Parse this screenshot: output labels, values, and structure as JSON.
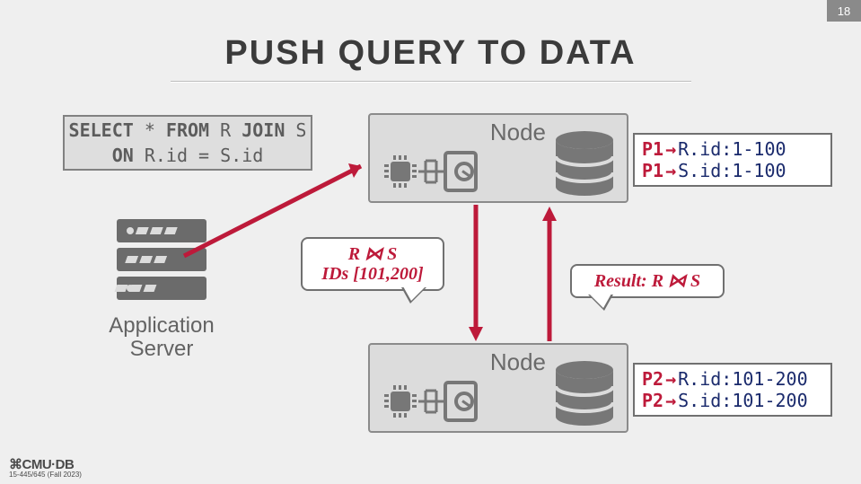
{
  "page_number": "18",
  "title": "PUSH QUERY TO DATA",
  "footer": {
    "logo": "⌘CMU·DB",
    "course": "15-445/645 (Fall 2023)"
  },
  "sql": {
    "line1_kw1": "SELECT",
    "line1_mid": " * ",
    "line1_kw2": "FROM",
    "line1_r": " R ",
    "line1_kw3": "JOIN",
    "line1_s": " S",
    "line2_kw": "ON",
    "line2_cond": " R.id = S.id"
  },
  "appserver_label_l1": "Application",
  "appserver_label_l2": "Server",
  "node_label": "Node",
  "partitions": {
    "p1": [
      {
        "p": "P1",
        "range": "R.id:1-100"
      },
      {
        "p": "P1",
        "range": "S.id:1-100"
      }
    ],
    "p2": [
      {
        "p": "P2",
        "range": "R.id:101-200"
      },
      {
        "p": "P2",
        "range": "S.id:101-200"
      }
    ]
  },
  "bubble1_l1": "R ⋈ S",
  "bubble1_l2": "IDs [101,200]",
  "bubble2": "Result: R ⋈ S"
}
